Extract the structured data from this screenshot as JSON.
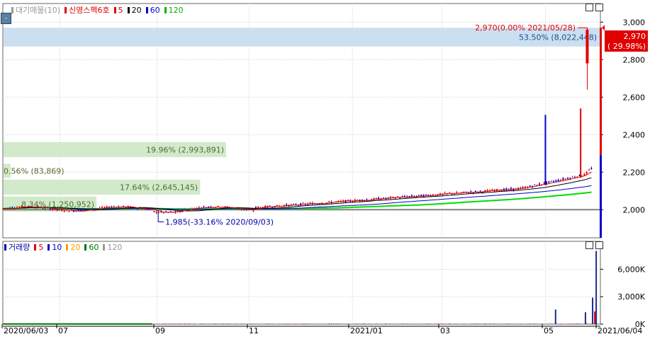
{
  "price_panel": {
    "legend": [
      {
        "name": "대기매물(10)",
        "color": "#999999"
      },
      {
        "name": "신영스팩6호",
        "color": "#e00000"
      },
      {
        "name": "5",
        "color": "#e00000"
      },
      {
        "name": "20",
        "color": "#000000"
      },
      {
        "name": "60",
        "color": "#0000cc"
      },
      {
        "name": "120",
        "color": "#00b000"
      }
    ],
    "toggle_label": "-"
  },
  "volume_panel": {
    "legend": [
      {
        "name": "거래량",
        "color": "#0000aa"
      },
      {
        "name": "5",
        "color": "#e00000"
      },
      {
        "name": "10",
        "color": "#0000cc"
      },
      {
        "name": "20",
        "color": "#ff9900"
      },
      {
        "name": "60",
        "color": "#007700"
      },
      {
        "name": "120",
        "color": "#999999"
      }
    ]
  },
  "colors": {
    "up": "#e00000",
    "down": "#0000cc",
    "ma120": "#00dd00",
    "base_line": "#808080",
    "bar_green": "#cde8c5",
    "bar_blue": "#c5dcef"
  },
  "chart_data": [
    {
      "type": "candlestick",
      "title": "신영스팩6호",
      "ylim": [
        1850,
        3050
      ],
      "yticks": [
        {
          "value": 2000,
          "label": "2,000"
        },
        {
          "value": 2200,
          "label": "2,200"
        },
        {
          "value": 2400,
          "label": "2,400"
        },
        {
          "value": 2600,
          "label": "2,600"
        },
        {
          "value": 2800,
          "label": "2,800"
        },
        {
          "value": 3000,
          "label": "3,000"
        }
      ],
      "current_price": {
        "value": 2970,
        "label": "2,970",
        "change": "( 29.98%)"
      },
      "annotations": {
        "high": {
          "value": 2970,
          "text": "2,970(0.00% 2021/05/28)"
        },
        "low": {
          "value": 1985,
          "text": "1,985(-33.16% 2020/09/03)"
        },
        "base_price": 2000
      },
      "volume_profile": [
        {
          "low": 2870,
          "high": 2970,
          "pct": 53.5,
          "label": "53.50% (8,022,448)",
          "color": "blue"
        },
        {
          "low": 2280,
          "high": 2360,
          "pct": 19.96,
          "label": "19.96% (2,993,891)",
          "color": "green"
        },
        {
          "low": 2170,
          "high": 2245,
          "pct": 0.56,
          "label": "0.56% (83,869)",
          "color": "green"
        },
        {
          "low": 2080,
          "high": 2160,
          "pct": 17.64,
          "label": "17.64% (2,645,145)",
          "color": "green"
        },
        {
          "low": 1990,
          "high": 2070,
          "pct": 8.34,
          "label": "8.34% (1,250,952)",
          "color": "green"
        }
      ],
      "x_ticks": [
        "2020/06/03",
        "07",
        "09",
        "11",
        "2021/01",
        "03",
        "05",
        "2021/06/04"
      ],
      "series": [
        {
          "name": "5",
          "color": "#e00000"
        },
        {
          "name": "20",
          "color": "#000000"
        },
        {
          "name": "60",
          "color": "#0000cc"
        },
        {
          "name": "120",
          "color": "#00b000"
        }
      ]
    },
    {
      "type": "bar",
      "title": "거래량",
      "ylim": [
        0,
        8200
      ],
      "yticks": [
        {
          "value": 0,
          "label": "0K"
        },
        {
          "value": 3000,
          "label": "3,000K"
        },
        {
          "value": 6000,
          "label": "6,000K"
        }
      ],
      "spikes": [
        {
          "pos": 0.925,
          "value": 1600
        },
        {
          "pos": 0.975,
          "value": 1300
        },
        {
          "pos": 0.987,
          "value": 2900
        },
        {
          "pos": 0.993,
          "value": 8000
        }
      ]
    }
  ]
}
